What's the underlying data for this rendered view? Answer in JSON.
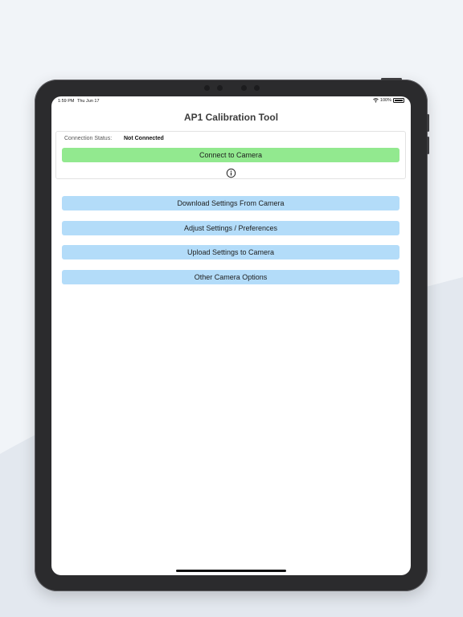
{
  "status_bar": {
    "time": "1:59 PM",
    "date": "Thu Jun 17",
    "battery": "100%"
  },
  "app": {
    "title": "AP1 Calibration Tool"
  },
  "connection": {
    "status_label": "Connection Status:",
    "status_value": "Not Connected",
    "connect_label": "Connect to Camera",
    "info_icon": "info-circle-icon"
  },
  "menu": [
    {
      "label": "Download Settings From Camera"
    },
    {
      "label": "Adjust Settings / Preferences"
    },
    {
      "label": "Upload Settings to Camera"
    },
    {
      "label": "Other Camera Options"
    }
  ],
  "colors": {
    "connect_button": "#92e98f",
    "menu_button": "#b3dcf9",
    "device_frame": "#2b2b2d",
    "background": "#f1f4f8"
  }
}
